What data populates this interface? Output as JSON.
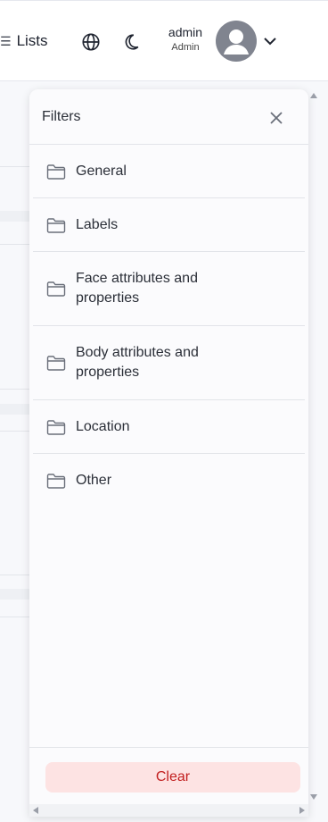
{
  "header": {
    "lists_label": "Lists",
    "user_name": "admin",
    "user_role": "Admin",
    "icons": [
      "menu-icon",
      "globe-icon",
      "moon-icon",
      "user-avatar-icon",
      "chevron-down-icon"
    ]
  },
  "filters": {
    "title": "Filters",
    "items": [
      {
        "label": "General"
      },
      {
        "label": "Labels"
      },
      {
        "label": "Face attributes and properties"
      },
      {
        "label": "Body attributes and properties"
      },
      {
        "label": "Location"
      },
      {
        "label": "Other"
      }
    ],
    "clear_label": "Clear"
  },
  "colors": {
    "clear_bg": "#fde3e3",
    "clear_text": "#c21f1f",
    "avatar": "#80848f"
  }
}
